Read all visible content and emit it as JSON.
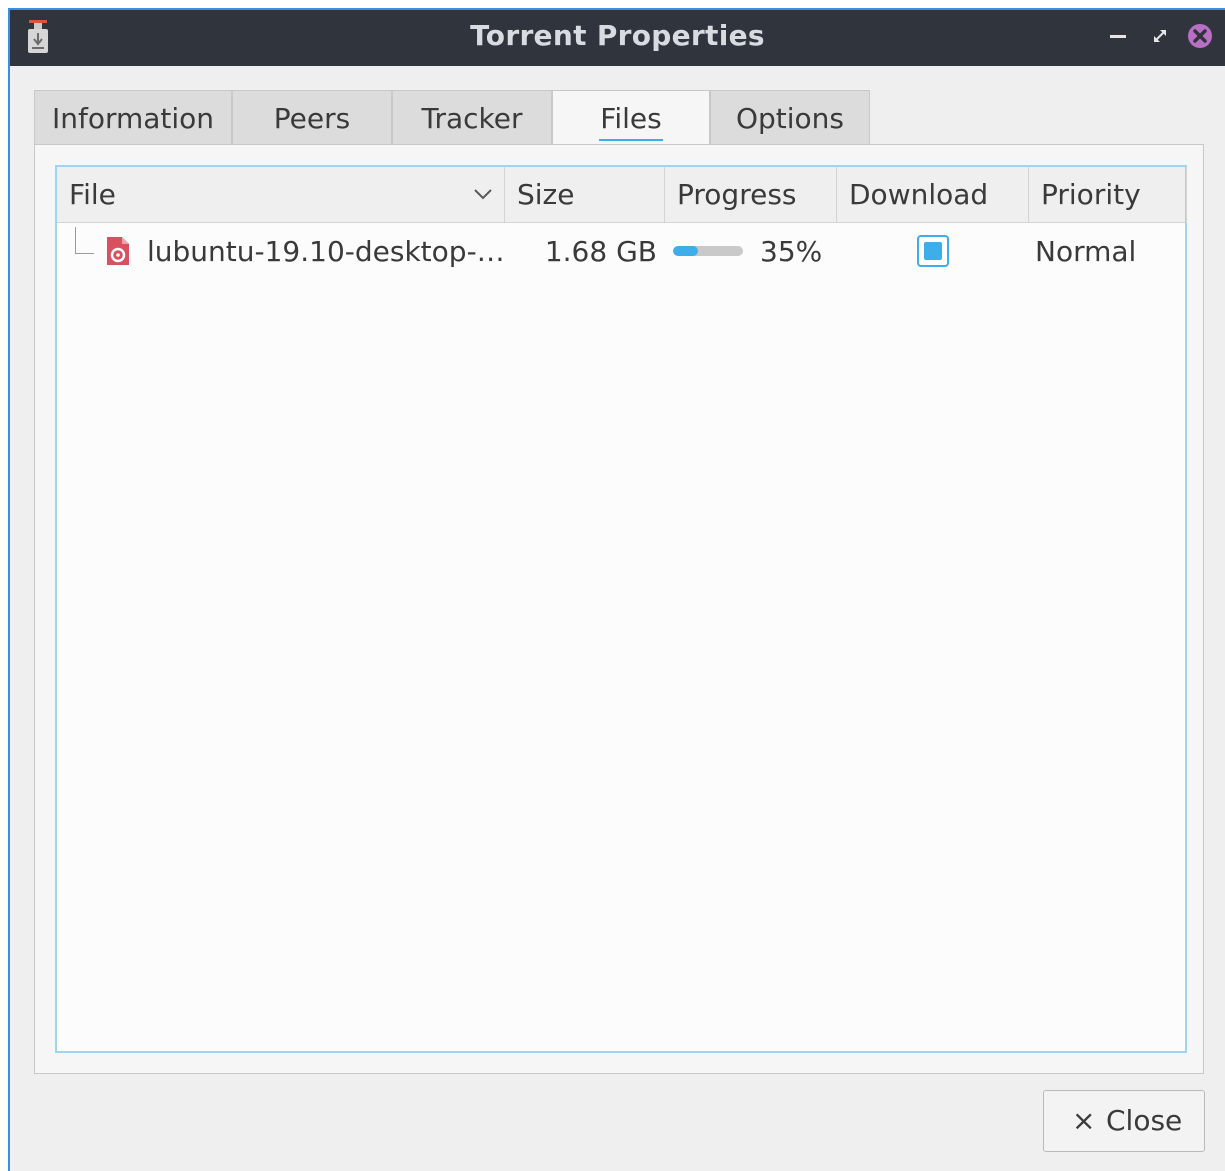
{
  "window": {
    "title": "Torrent Properties"
  },
  "tabs": [
    {
      "label": "Information",
      "active": false
    },
    {
      "label": "Peers",
      "active": false
    },
    {
      "label": "Tracker",
      "active": false
    },
    {
      "label": "Files",
      "active": true
    },
    {
      "label": "Options",
      "active": false
    }
  ],
  "table": {
    "columns": [
      "File",
      "Size",
      "Progress",
      "Download",
      "Priority"
    ],
    "sort_column": "File",
    "sort_icon": "chevron-down-icon",
    "rows": [
      {
        "file": "lubuntu-19.10-desktop-…",
        "file_icon": "iso-file-icon",
        "size": "1.68 GB",
        "progress_value": 0.35,
        "progress_text": "35%",
        "download": "checked",
        "priority": "Normal"
      }
    ]
  },
  "buttons": {
    "close_icon": "×",
    "close_label": "Close"
  },
  "colors": {
    "accent": "#3daee9",
    "titlebar": "#2f343d",
    "window_bg": "#efefef",
    "close_button": "#b86fc4",
    "file_icon": "#d9505e"
  }
}
